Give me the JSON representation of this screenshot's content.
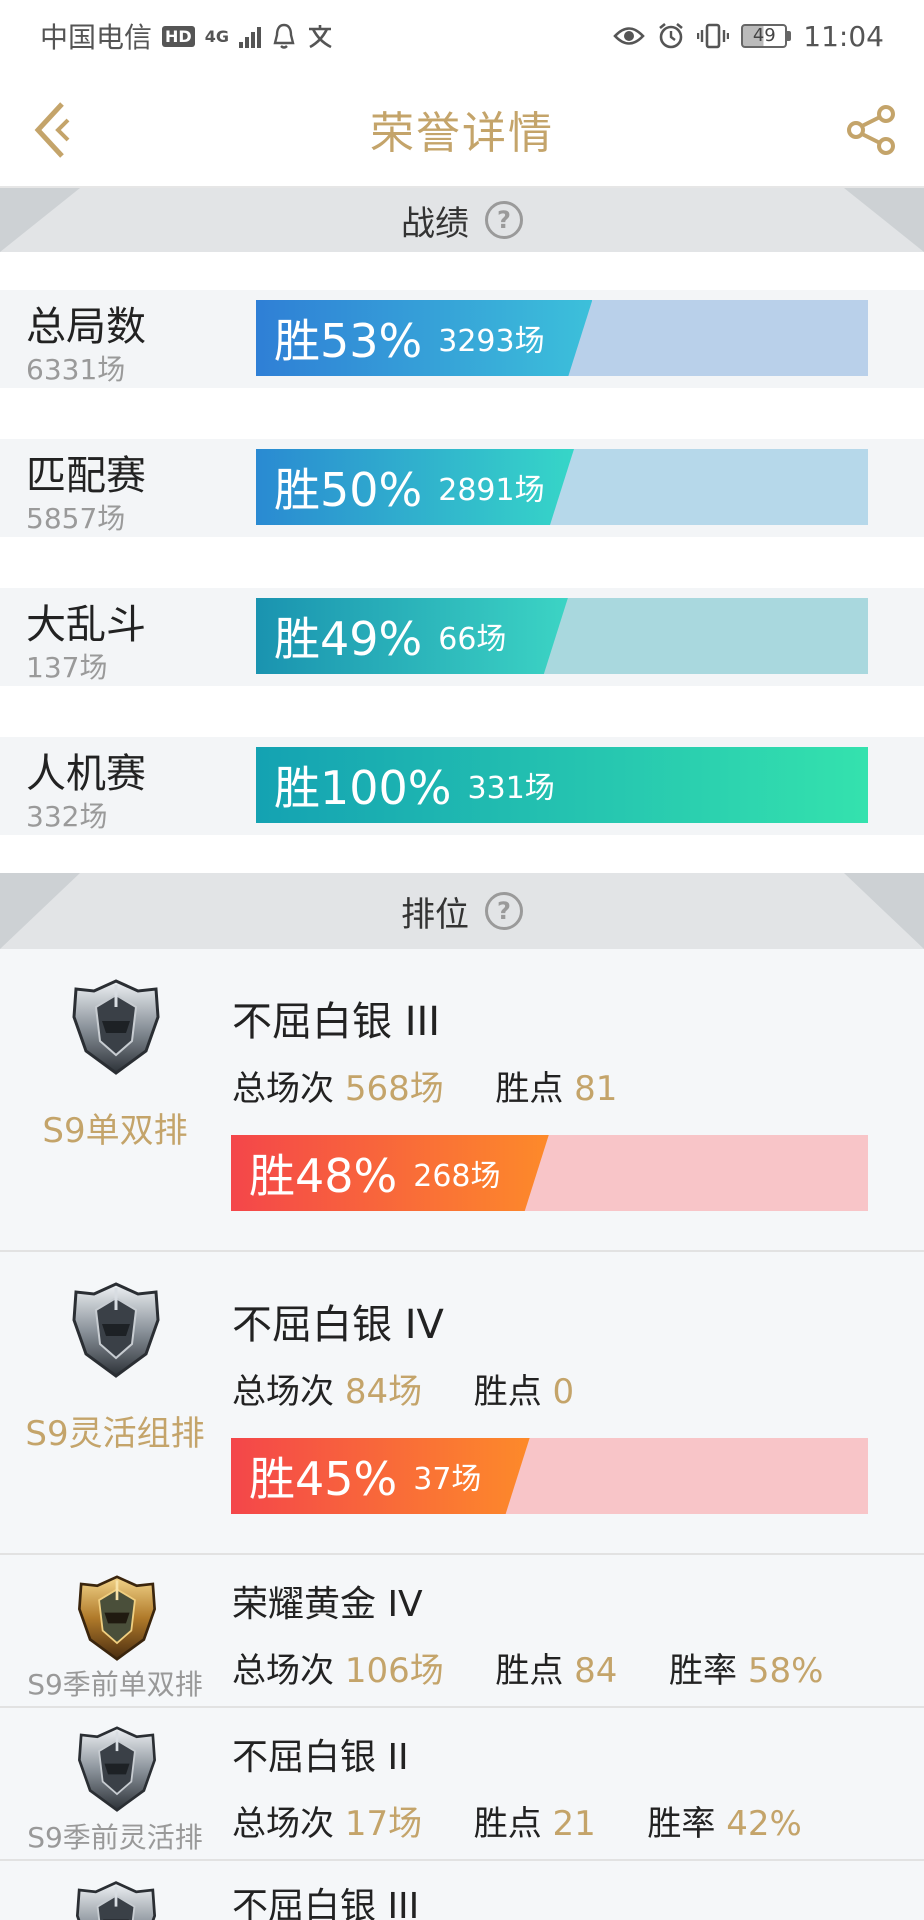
{
  "status_bar": {
    "carrier": "中国电信",
    "hd": "HD",
    "network": "4G",
    "battery": "49",
    "time": "11:04"
  },
  "header": {
    "title": "荣誉详情"
  },
  "stats_section": {
    "title": "战绩",
    "rows": [
      {
        "name": "总局数",
        "count": "6331场",
        "win_rate_text": "胜53%",
        "wins_text": "3293场",
        "win_rate": 0.53,
        "bg": "#b9d0ea",
        "fill_from": "#2f7fd6",
        "fill_to": "#3cc0da"
      },
      {
        "name": "匹配赛",
        "count": "5857场",
        "win_rate_text": "胜50%",
        "wins_text": "2891场",
        "win_rate": 0.5,
        "bg": "#b6d8ea",
        "fill_from": "#2a8ad2",
        "fill_to": "#36d6c8"
      },
      {
        "name": "大乱斗",
        "count": "137场",
        "win_rate_text": "胜49%",
        "wins_text": "66场",
        "win_rate": 0.49,
        "bg": "#a9d8de",
        "fill_from": "#1a93b0",
        "fill_to": "#3cd4c4"
      },
      {
        "name": "人机赛",
        "count": "332场",
        "win_rate_text": "胜100%",
        "wins_text": "331场",
        "win_rate": 1.0,
        "bg": "#a9e6d6",
        "fill_from": "#14a2b2",
        "fill_to": "#34e2ae"
      }
    ]
  },
  "ranked_section": {
    "title": "排位",
    "labels": {
      "total": "总场次",
      "points": "胜点",
      "rate": "胜率"
    },
    "rows": [
      {
        "mode": "S9单双排",
        "tier": "不屈白银 III",
        "total": "568场",
        "points": "81",
        "win_rate_text": "胜48%",
        "wins_text": "268场",
        "win_rate": 0.48,
        "emblem": "silver"
      },
      {
        "mode": "S9灵活组排",
        "tier": "不屈白银 IV",
        "total": "84场",
        "points": "0",
        "win_rate_text": "胜45%",
        "wins_text": "37场",
        "win_rate": 0.45,
        "emblem": "silver"
      },
      {
        "mode": "S9季前单双排",
        "tier": "荣耀黄金 IV",
        "total": "106场",
        "points": "84",
        "rate": "58%",
        "emblem": "gold"
      },
      {
        "mode": "S9季前灵活排",
        "tier": "不屈白银 II",
        "total": "17场",
        "points": "21",
        "rate": "42%",
        "emblem": "silver"
      },
      {
        "tier": "不屈白银 III",
        "emblem": "silver"
      }
    ]
  },
  "icons": {
    "back": "back-chevron-icon",
    "share": "share-icon",
    "help": "help-circle-icon",
    "emblem_silver": "silver-rank-emblem-icon",
    "emblem_gold": "gold-rank-emblem-icon"
  },
  "colors": {
    "accent": "#c4a46a",
    "rank_bar_bg": "#f8c5c8",
    "rank_fill_from": "#f4464a",
    "rank_fill_to": "#fd8a2a"
  }
}
